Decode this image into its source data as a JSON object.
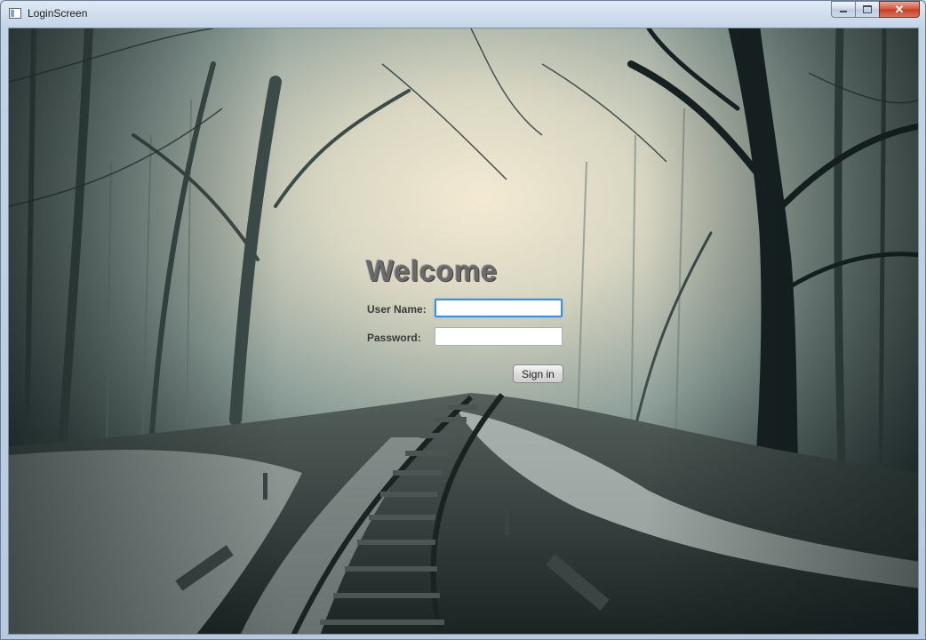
{
  "window": {
    "title": "LoginScreen"
  },
  "login": {
    "heading": "Welcome",
    "username_label": "User Name:",
    "username_value": "",
    "password_label": "Password:",
    "password_value": "",
    "signin_label": "Sign in"
  },
  "colors": {
    "accent_focus": "#3b8fde",
    "heading": "#6a6a6a",
    "close_button": "#c43b22"
  }
}
